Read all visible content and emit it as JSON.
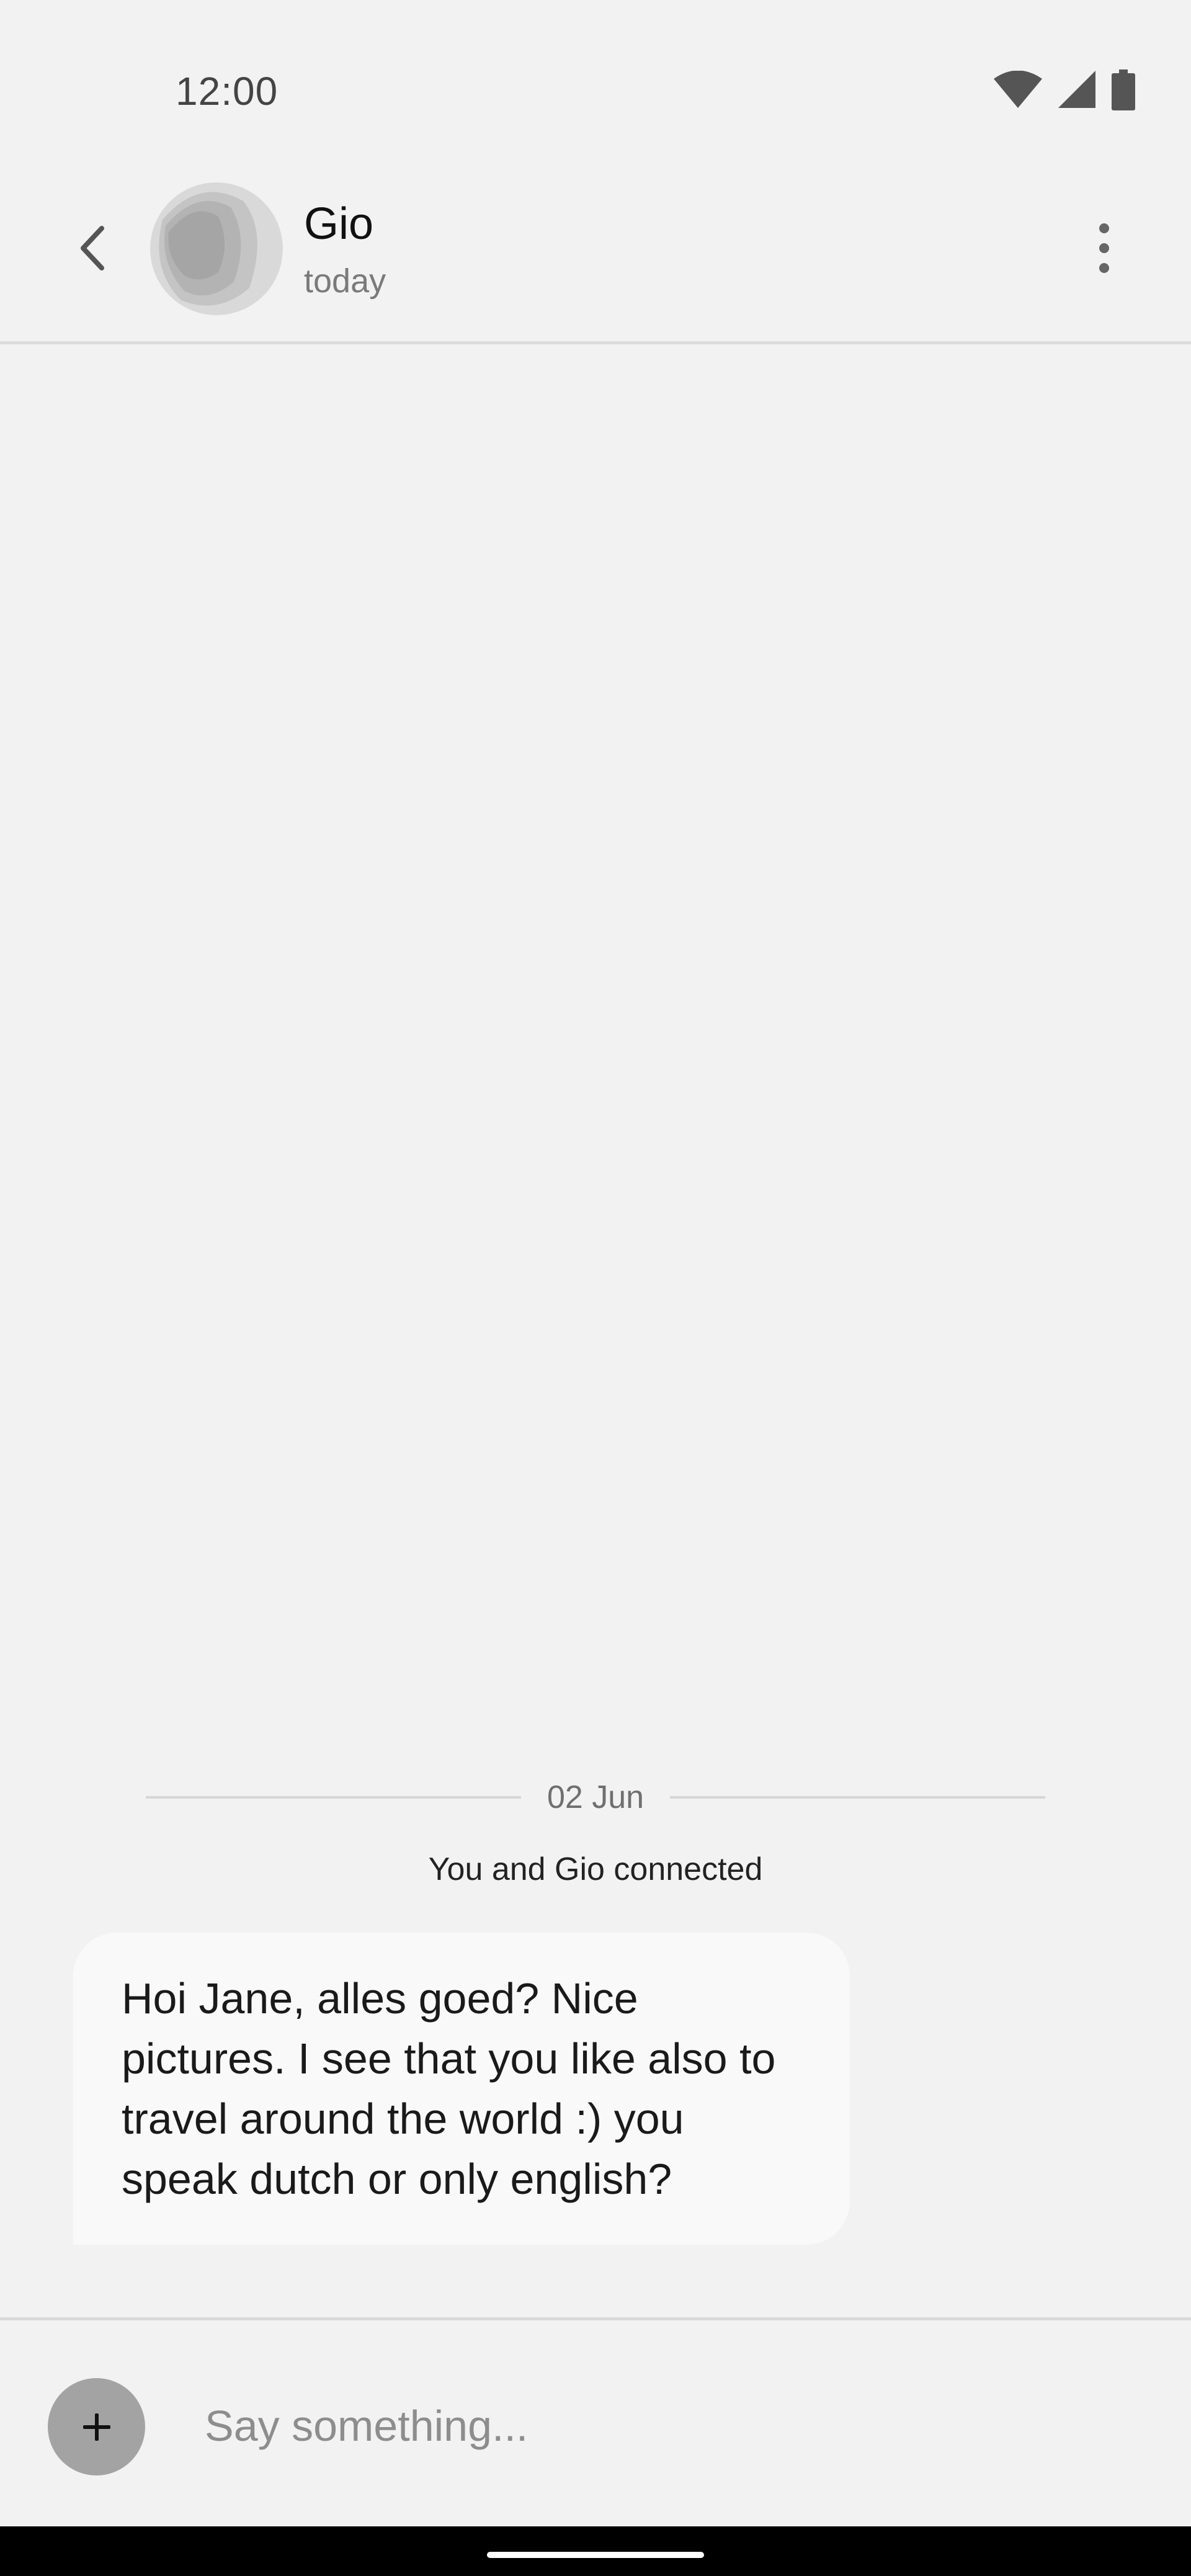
{
  "status_bar": {
    "time": "12:00",
    "icons": [
      "wifi-icon",
      "cellular-signal-icon",
      "battery-icon"
    ]
  },
  "header": {
    "back_icon": "chevron-left-icon",
    "contact_name": "Gio",
    "contact_status": "today",
    "menu_icon": "more-vertical-icon"
  },
  "conversation": {
    "date_separator": "02 Jun",
    "system_message": "You and Gio connected",
    "messages": [
      {
        "direction": "incoming",
        "text": "Hoi Jane, alles goed? Nice pictures. I see that you like also to travel around the world :) you speak dutch or only english?"
      }
    ]
  },
  "composer": {
    "add_icon": "plus-icon",
    "placeholder": "Say something..."
  },
  "colors": {
    "background": "#f2f2f2",
    "bubble_incoming": "#f9f9f9",
    "add_button": "#a3a3a3",
    "nav_bar": "#000000"
  }
}
